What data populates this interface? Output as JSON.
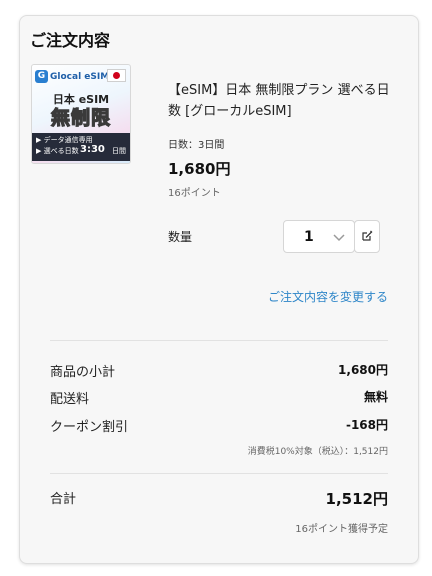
{
  "order": {
    "title": "ご注文内容",
    "product": {
      "image": {
        "logo_mark": "G",
        "logo_text": "Glocal eSIM",
        "flag_icon": "japan-flag-icon",
        "line1": "日本 eSIM",
        "line2": "無制限",
        "bullet1": "▶ データ通信専用",
        "bullet2": "▶ 選べる日数",
        "duration": "3:30",
        "duration_unit": "日間"
      },
      "name": "【eSIM】日本 無制限プラン 選べる日数 [グローカルeSIM]",
      "days": "日数：3日間",
      "price": "1,680円",
      "points": "16ポイント"
    },
    "quantity": {
      "label": "数量",
      "value": "1",
      "chevron_icon": "chevron-down-icon",
      "edit_icon": "edit-icon"
    },
    "change_link": "ご注文内容を変更する",
    "summary": {
      "subtotal_label": "商品の小計",
      "subtotal_value": "1,680円",
      "shipping_label": "配送料",
      "shipping_value": "無料",
      "coupon_label": "クーポン割引",
      "coupon_value": "-168円",
      "tax_note": "消費税10%対象（税込）：1,512円",
      "total_label": "合計",
      "total_value": "1,512円",
      "earn_note": "16ポイント獲得予定"
    }
  }
}
